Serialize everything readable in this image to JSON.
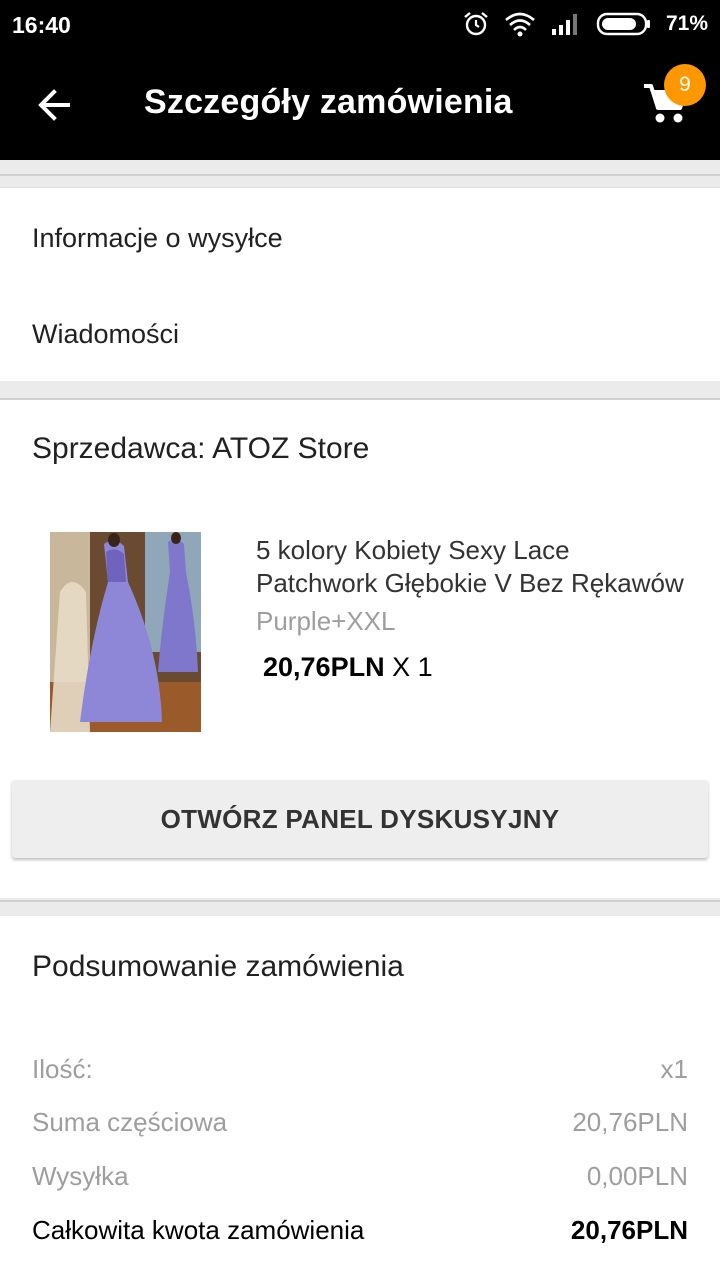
{
  "status_bar": {
    "time": "16:40",
    "battery": "71%",
    "icons": [
      "alarm-icon",
      "wifi-icon",
      "signal-icon",
      "battery-icon"
    ]
  },
  "app_bar": {
    "title": "Szczegóły zamówienia",
    "back_icon": "arrow-left-icon",
    "cart_icon": "cart-icon",
    "cart_count": "9"
  },
  "info_section": {
    "shipping_label": "Informacje o wysyłce",
    "messages_label": "Wiadomości"
  },
  "seller_section": {
    "seller": "Sprzedawca: ATOZ Store",
    "product": {
      "title_line1": "5 kolory Kobiety Sexy Lace",
      "title_line2": "Patchwork Głębokie V Bez Rękawów",
      "variant": "Purple+XXL",
      "price": "20,76PLN",
      "quantity": "X 1"
    },
    "dispute_button": "OTWÓRZ PANEL DYSKUSYJNY"
  },
  "summary": {
    "title": "Podsumowanie zamówienia",
    "rows": [
      {
        "label": "Ilość:",
        "value": "x1"
      },
      {
        "label": "Suma częściowa",
        "value": "20,76PLN"
      },
      {
        "label": "Wysyłka",
        "value": "0,00PLN"
      },
      {
        "label": "Całkowita kwota zamówienia",
        "value": "20,76PLN"
      }
    ]
  },
  "colors": {
    "app_bar": "#000000",
    "badge": "#ff9800",
    "muted_text": "#9e9e9e",
    "dress": "#8e86d6"
  }
}
